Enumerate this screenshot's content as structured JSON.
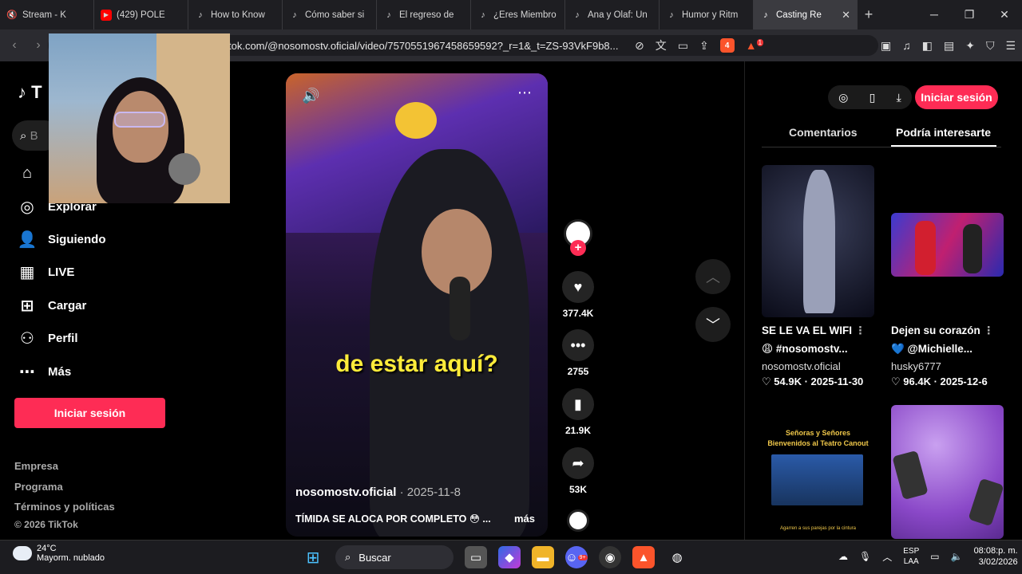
{
  "browser": {
    "tabs": [
      {
        "label": "Stream - K",
        "icon": "mute-icon"
      },
      {
        "label": "(429) POLÉ",
        "icon": "youtube-icon"
      },
      {
        "label": "How to Know",
        "icon": "tiktok-icon"
      },
      {
        "label": "Cómo saber si",
        "icon": "tiktok-icon"
      },
      {
        "label": "El regreso de",
        "icon": "tiktok-icon"
      },
      {
        "label": "¿Eres Miembro",
        "icon": "tiktok-icon"
      },
      {
        "label": "Ana y Olaf: Un",
        "icon": "tiktok-icon"
      },
      {
        "label": "Humor y Ritm",
        "icon": "tiktok-icon"
      },
      {
        "label": "Casting Re",
        "icon": "tiktok-icon",
        "active": true
      }
    ],
    "url": "tok.com/@nosomostv.oficial/video/7570551967458659592?_r=1&_t=ZS-93VkF9b8...",
    "brave_badge": "4",
    "alert_badge": "1"
  },
  "sidebar": {
    "logo": "T",
    "search_placeholder": "B",
    "items": [
      {
        "label": "Explorar",
        "icon": "compass-icon"
      },
      {
        "label": "Siguiendo",
        "icon": "following-icon"
      },
      {
        "label": "LIVE",
        "icon": "live-icon"
      },
      {
        "label": "Cargar",
        "icon": "upload-icon"
      },
      {
        "label": "Perfil",
        "icon": "profile-icon"
      },
      {
        "label": "Más",
        "icon": "more-icon"
      }
    ],
    "login": "Iniciar sesión",
    "footer": [
      "Empresa",
      "Programa",
      "Términos y políticas",
      "© 2026 TikTok"
    ]
  },
  "video": {
    "caption": "de estar aquí?",
    "author": "nosomostv.oficial",
    "date": " · 2025-11-8",
    "description": "TÍMIDA SE ALOCA POR COMPLETO 😳 ...",
    "more": "más"
  },
  "actions": {
    "likes": "377.4K",
    "comments": "2755",
    "saves": "21.9K",
    "shares": "53K"
  },
  "right_panel": {
    "login": "Iniciar sesión",
    "tab_comments": "Comentarios",
    "tab_interest": "Podría interesarte",
    "cards": [
      {
        "title": "SE LE VA EL WIFI",
        "title2": "😩 #nosomostv...",
        "author": "nosomostv.oficial",
        "stats": "♡ 54.9K · 2025-11-30"
      },
      {
        "title": "Dejen su corazón",
        "title2": "💙 @Michielle...",
        "author": "husky6777",
        "stats": "♡ 96.4K · 2025-12-6"
      }
    ],
    "thumb3_line1": "Señoras y Señores",
    "thumb3_line2": "Bienvenidos al Teatro Canout",
    "thumb3_bottom": "Agarren a sus parejas por la cintura"
  },
  "taskbar": {
    "temp": "24°C",
    "weather": "Mayorm. nublado",
    "search": "Buscar",
    "lang1": "ESP",
    "lang2": "LAA",
    "time": "08:08:p. m.",
    "date": "3/02/2026",
    "discord_badge": "9+"
  }
}
